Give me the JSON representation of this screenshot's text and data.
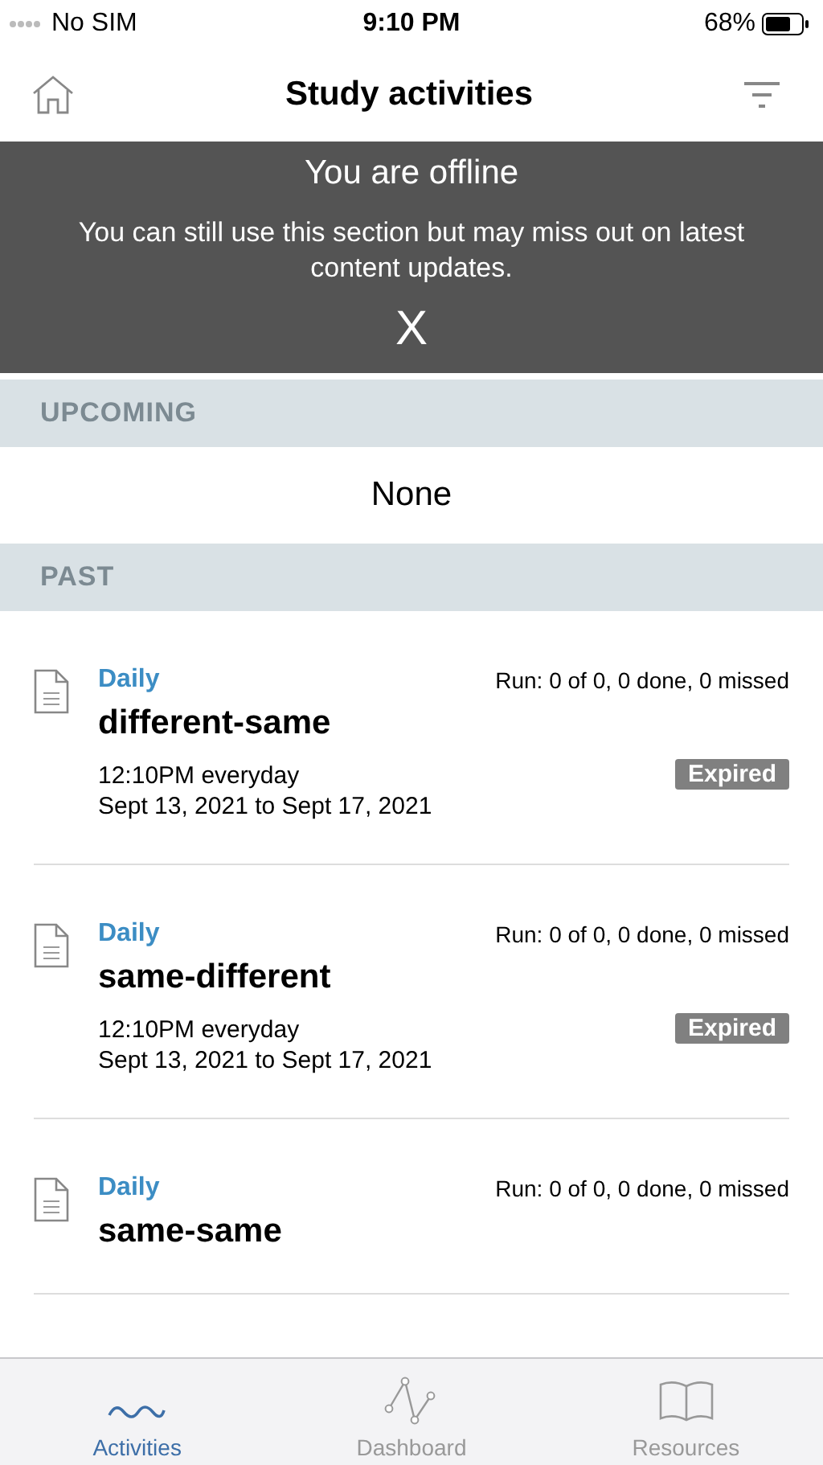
{
  "status_bar": {
    "carrier": "No SIM",
    "time": "9:10 PM",
    "battery": "68%"
  },
  "nav": {
    "title": "Study activities"
  },
  "offline_banner": {
    "title": "You are offline",
    "message": "You can still use this section but may miss out on latest content updates.",
    "close": "X"
  },
  "sections": [
    {
      "kind": "empty",
      "header": "UPCOMING",
      "empty_text": "None"
    },
    {
      "kind": "list",
      "header": "PAST",
      "activities": [
        {
          "frequency": "Daily",
          "run": "Run: 0 of 0, 0 done, 0 missed",
          "name": "different-same",
          "schedule": "12:10PM everyday",
          "dates": "Sept 13, 2021 to Sept 17, 2021",
          "status": "Expired"
        },
        {
          "frequency": "Daily",
          "run": "Run: 0 of 0, 0 done, 0 missed",
          "name": "same-different",
          "schedule": "12:10PM everyday",
          "dates": "Sept 13, 2021 to Sept 17, 2021",
          "status": "Expired"
        },
        {
          "frequency": "Daily",
          "run": "Run: 0 of 0, 0 done, 0 missed",
          "name": "same-same"
        }
      ]
    }
  ],
  "tab_bar": [
    {
      "kind": "activities",
      "label": "Activities",
      "selected": true
    },
    {
      "kind": "dashboard",
      "label": "Dashboard",
      "selected": false
    },
    {
      "kind": "resources",
      "label": "Resources",
      "selected": false
    }
  ]
}
